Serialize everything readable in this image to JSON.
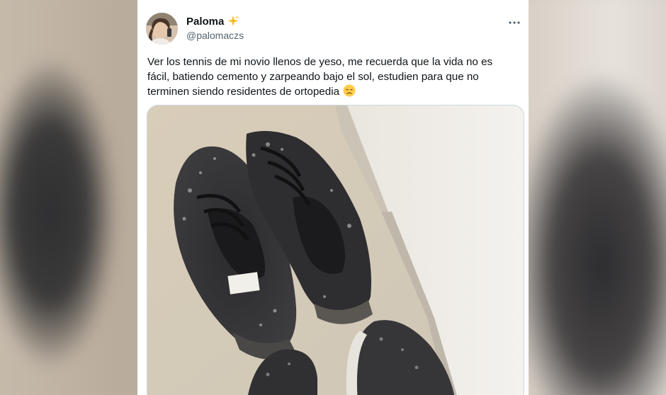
{
  "tweet": {
    "display_name": "Paloma",
    "handle": "@palomaczs",
    "text": "Ver los tennis de mi novio llenos de yeso, me recuerda que la vida no es fácil, batiendo cemento y zarpeando bajo el sol, estudien para que no terminen siendo residentes de ortopedia",
    "emoji": "disappointed-face-icon",
    "badge": "sparkles-icon",
    "more": "more-options-icon"
  },
  "media": {
    "alt_description": "photo"
  },
  "colors": {
    "text": "#0f1419",
    "secondary_text": "#536471",
    "border": "#cfd9de"
  }
}
